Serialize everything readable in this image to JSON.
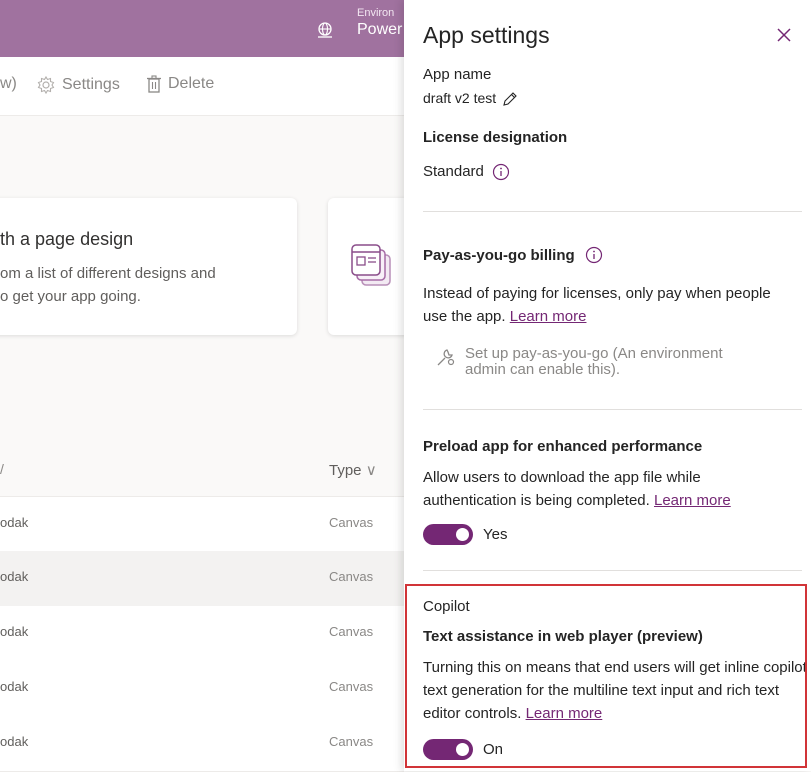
{
  "header": {
    "env_label": "Environ",
    "env_name": "Power",
    "colors": {
      "bar": "#a0729f",
      "accent": "#742774",
      "highlight": "#d13438"
    }
  },
  "commandbar": {
    "partial_label": "w)",
    "settings_label": "Settings",
    "delete_label": "Delete"
  },
  "start": {
    "card_title": "th a page design",
    "card_desc_line1": "om a list of different designs and",
    "card_desc_line2": "o get your app going."
  },
  "table": {
    "header_type": "Type",
    "rows": [
      {
        "name": "odak",
        "type": "Canvas"
      },
      {
        "name": "odak",
        "type": "Canvas"
      },
      {
        "name": "odak",
        "type": "Canvas"
      },
      {
        "name": "odak",
        "type": "Canvas"
      },
      {
        "name": "odak",
        "type": "Canvas"
      }
    ]
  },
  "panel": {
    "title": "App settings",
    "app_name_label": "App name",
    "app_name_value": "draft v2 test",
    "license_heading": "License designation",
    "license_value": "Standard",
    "payg_heading": "Pay-as-you-go billing",
    "payg_desc": "Instead of paying for licenses, only pay when people use the app.",
    "payg_link": "Learn more",
    "payg_setup_line1": "Set up pay-as-you-go (An environment",
    "payg_setup_line2": "admin can enable this).",
    "preload_heading": "Preload app for enhanced performance",
    "preload_desc": "Allow users to download the app file while authentication is being completed.",
    "preload_link": "Learn more",
    "preload_toggle_label": "Yes",
    "copilot_heading": "Copilot",
    "text_assist_heading": "Text assistance in web player (preview)",
    "text_assist_desc": "Turning this on means that end users will get inline copilot text generation for the multiline text input and rich text editor controls.",
    "text_assist_link": "Learn more",
    "text_assist_toggle_label": "On"
  }
}
